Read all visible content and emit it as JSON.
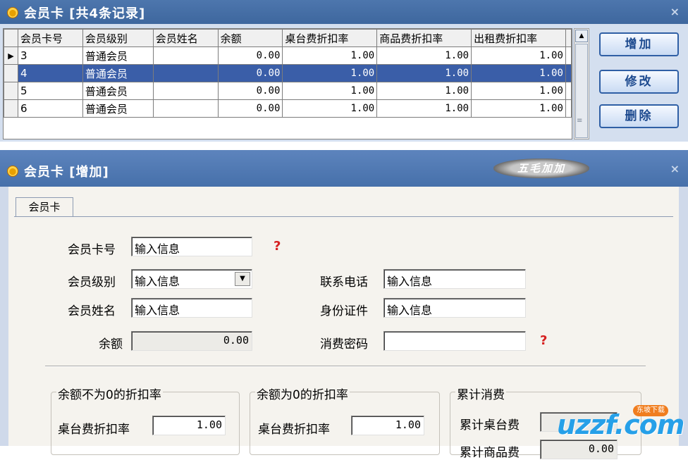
{
  "list_window": {
    "title": "会员卡 [共4条记录]",
    "close": "×",
    "columns": [
      "会员卡号",
      "会员级别",
      "会员姓名",
      "余额",
      "桌台费折扣率",
      "商品费折扣率",
      "出租费折扣率"
    ],
    "rows": [
      {
        "indicator": "▶",
        "card_no": "3",
        "level": "普通会员",
        "name": "",
        "balance": "0.00",
        "table_rate": "1.00",
        "goods_rate": "1.00",
        "rent_rate": "1.00"
      },
      {
        "indicator": "",
        "card_no": "4",
        "level": "普通会员",
        "name": "",
        "balance": "0.00",
        "table_rate": "1.00",
        "goods_rate": "1.00",
        "rent_rate": "1.00"
      },
      {
        "indicator": "",
        "card_no": "5",
        "level": "普通会员",
        "name": "",
        "balance": "0.00",
        "table_rate": "1.00",
        "goods_rate": "1.00",
        "rent_rate": "1.00"
      },
      {
        "indicator": "",
        "card_no": "6",
        "level": "普通会员",
        "name": "",
        "balance": "0.00",
        "table_rate": "1.00",
        "goods_rate": "1.00",
        "rent_rate": "1.00"
      }
    ],
    "selected_row": 1,
    "buttons": {
      "add": "增加",
      "edit": "修改",
      "delete": "删除"
    }
  },
  "edit_window": {
    "title": "会员卡 [增加]",
    "close": "×",
    "badge": "五毛加加",
    "tab": "会员卡",
    "fields": {
      "card_no": {
        "label": "会员卡号",
        "value": "输入信息",
        "required": "?"
      },
      "level": {
        "label": "会员级别",
        "value": "输入信息"
      },
      "name": {
        "label": "会员姓名",
        "value": "输入信息"
      },
      "balance": {
        "label": "余额",
        "value": "0.00"
      },
      "phone": {
        "label": "联系电话",
        "value": "输入信息"
      },
      "id_card": {
        "label": "身份证件",
        "value": "输入信息"
      },
      "password": {
        "label": "消费密码",
        "value": "",
        "required": "?"
      }
    },
    "groups": {
      "nonzero": {
        "title": "余额不为0的折扣率",
        "table_rate_label": "桌台费折扣率",
        "table_rate": "1.00"
      },
      "zero": {
        "title": "余额为0的折扣率",
        "table_rate_label": "桌台费折扣率",
        "table_rate": "1.00"
      },
      "total": {
        "title": "累计消费",
        "table_fee_label": "累计桌台费",
        "goods_fee_label": "累计商品费",
        "goods_fee": "0.00"
      }
    }
  },
  "watermark": {
    "text": "uzzf.com",
    "tag": "东坡下载"
  }
}
